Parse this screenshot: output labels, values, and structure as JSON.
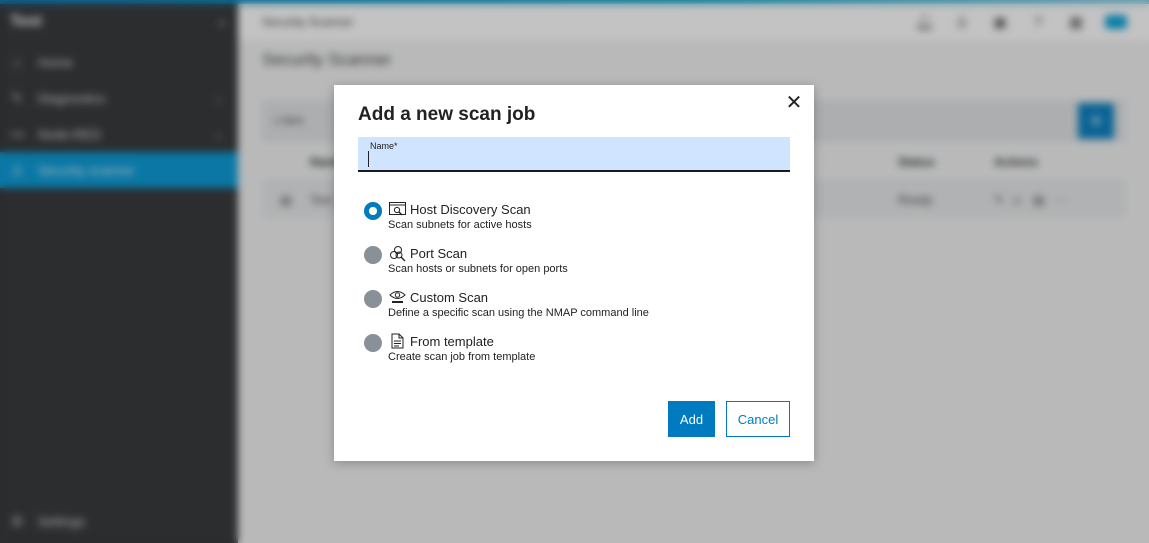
{
  "colors": {
    "accent": "#007bc0",
    "sidebar_active": "#0096d6",
    "name_field_bg": "#d1e4ff"
  },
  "sidebar": {
    "title": "Test",
    "items": [
      {
        "label": "Home",
        "icon": "home-icon"
      },
      {
        "label": "Diagnostics",
        "icon": "diagnostics-icon"
      },
      {
        "label": "Node-RED",
        "icon": "node-red-icon"
      },
      {
        "label": "Security scanner",
        "icon": "scanner-icon"
      }
    ],
    "settings_label": "Settings"
  },
  "header": {
    "breadcrumb": "Security Scanner",
    "page_title": "Security Scanner"
  },
  "table": {
    "item_count": "1 item",
    "columns": {
      "name": "Name",
      "status": "Status",
      "actions": "Actions"
    },
    "rows": [
      {
        "name": "Test",
        "status": "Ready"
      }
    ]
  },
  "dialog": {
    "title": "Add a new scan job",
    "name_label": "Name*",
    "name_value": "",
    "options": [
      {
        "title": "Host Discovery Scan",
        "desc": "Scan subnets for active hosts",
        "icon": "host-discovery-icon",
        "selected": true
      },
      {
        "title": "Port Scan",
        "desc": "Scan hosts or subnets for open ports",
        "icon": "port-scan-icon",
        "selected": false
      },
      {
        "title": "Custom Scan",
        "desc": "Define a specific scan using the NMAP command line",
        "icon": "nmap-eye-icon",
        "selected": false
      },
      {
        "title": "From template",
        "desc": "Create scan job from template",
        "icon": "template-icon",
        "selected": false
      }
    ],
    "add_label": "Add",
    "cancel_label": "Cancel",
    "close_glyph": "✕"
  }
}
